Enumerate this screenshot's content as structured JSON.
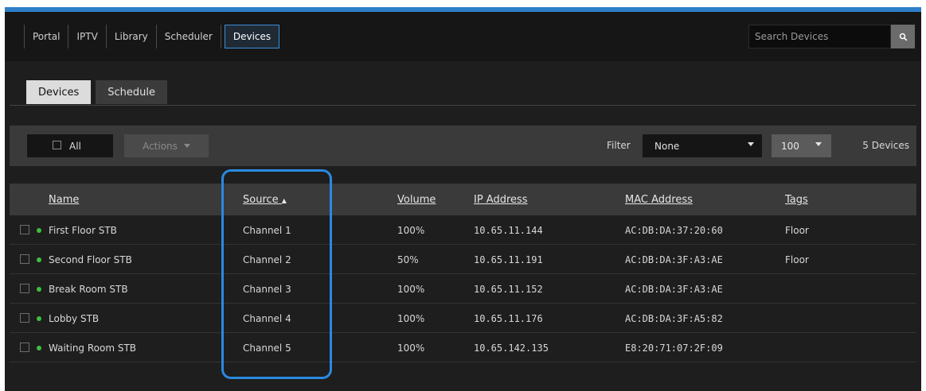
{
  "nav": {
    "items": [
      {
        "label": "Portal"
      },
      {
        "label": "IPTV"
      },
      {
        "label": "Library"
      },
      {
        "label": "Scheduler"
      },
      {
        "label": "Devices",
        "active": true
      }
    ]
  },
  "search": {
    "placeholder": "Search Devices",
    "value": "",
    "icon": "search-icon"
  },
  "subtabs": [
    {
      "label": "Devices",
      "active": true
    },
    {
      "label": "Schedule",
      "active": false
    }
  ],
  "toolbar": {
    "all_label": "All",
    "actions_label": "Actions",
    "filter_label": "Filter",
    "filter_value": "None",
    "per_page": "100",
    "count": "5 Devices"
  },
  "table": {
    "columns": {
      "name": "Name",
      "source": "Source",
      "volume": "Volume",
      "ip": "IP Address",
      "mac": "MAC Address",
      "tags": "Tags"
    },
    "sort_indicator": "▲",
    "rows": [
      {
        "name": "First Floor STB",
        "source": "Channel 1",
        "volume": "100%",
        "ip": "10.65.11.144",
        "mac": "AC:DB:DA:37:20:60",
        "tags": "Floor"
      },
      {
        "name": "Second Floor STB",
        "source": "Channel 2",
        "volume": "50%",
        "ip": "10.65.11.191",
        "mac": "AC:DB:DA:3F:A3:AE",
        "tags": "Floor"
      },
      {
        "name": "Break Room STB",
        "source": "Channel 3",
        "volume": "100%",
        "ip": "10.65.11.152",
        "mac": "AC:DB:DA:3F:A3:AE",
        "tags": ""
      },
      {
        "name": "Lobby STB",
        "source": "Channel 4",
        "volume": "100%",
        "ip": "10.65.11.176",
        "mac": "AC:DB:DA:3F:A5:82",
        "tags": ""
      },
      {
        "name": "Waiting Room STB",
        "source": "Channel 5",
        "volume": "100%",
        "ip": "10.65.142.135",
        "mac": "E8:20:71:07:2F:09",
        "tags": ""
      }
    ]
  },
  "colors": {
    "accent": "#2f7fc8",
    "status_online": "#3fbf3f",
    "highlight": "#2a8ae0"
  }
}
